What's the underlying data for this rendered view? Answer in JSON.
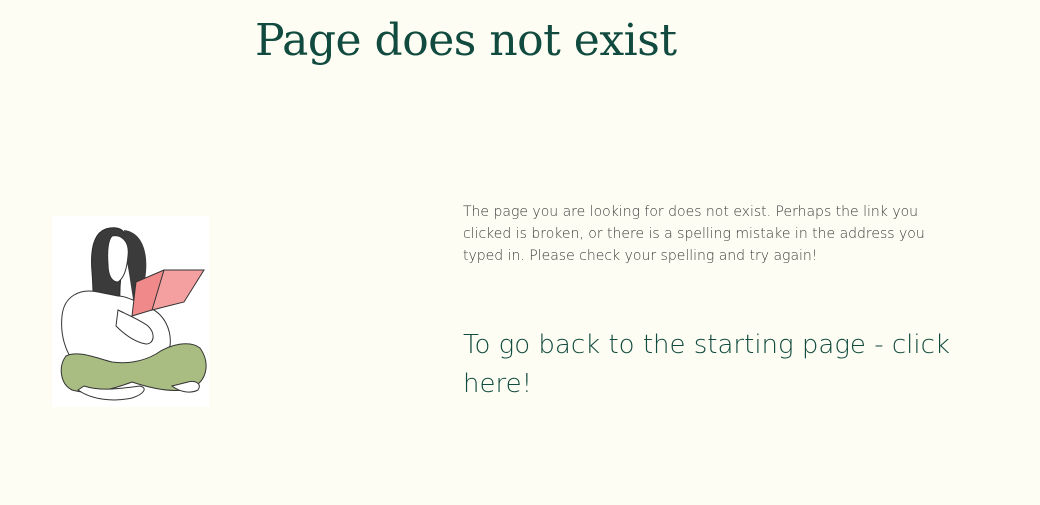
{
  "page": {
    "title": "Page does not exist",
    "message": "The page you are looking for does not exist. Perhaps the link you clicked is broken, or there is a spelling mistake in the address you typed in. Please check your spelling and try again!",
    "home_link_label": "To go back to the starting page - click here!"
  },
  "illustration": {
    "name": "woman-reading-book-illustration"
  },
  "colors": {
    "background": "#fdfdf3",
    "heading": "#114a3e",
    "body_text": "#3d3d3d",
    "book": "#f08a8a",
    "pants": "#a9bd82",
    "hair": "#3b3b3b"
  }
}
